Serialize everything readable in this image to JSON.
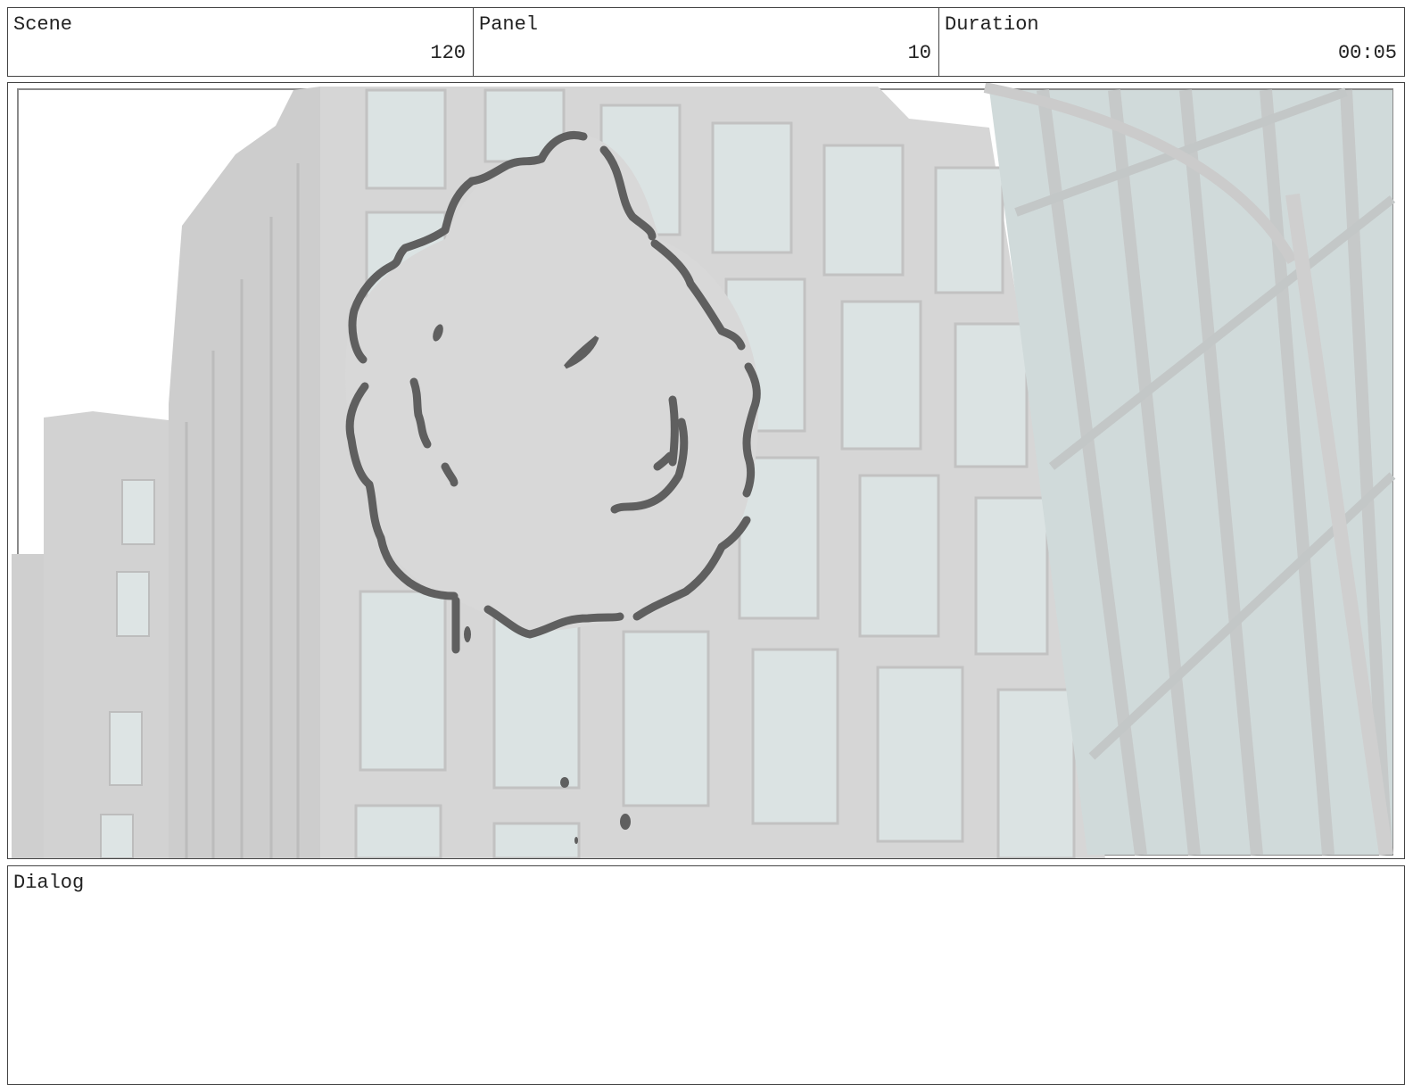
{
  "header": {
    "scene": {
      "label": "Scene",
      "value": "120"
    },
    "panel": {
      "label": "Panel",
      "value": "10"
    },
    "duration": {
      "label": "Duration",
      "value": "00:05"
    }
  },
  "artwork": {
    "description_icon": "storyboard-sketch-building-smoke",
    "colors": {
      "sky": "#ffffff",
      "building": "#d4d4d4",
      "window": "#d9e2e2",
      "glass": "#d2dcdc",
      "ink": "#5f5f5f",
      "cloud": "#d8d8d8"
    }
  },
  "dialog": {
    "label": "Dialog",
    "text": ""
  }
}
